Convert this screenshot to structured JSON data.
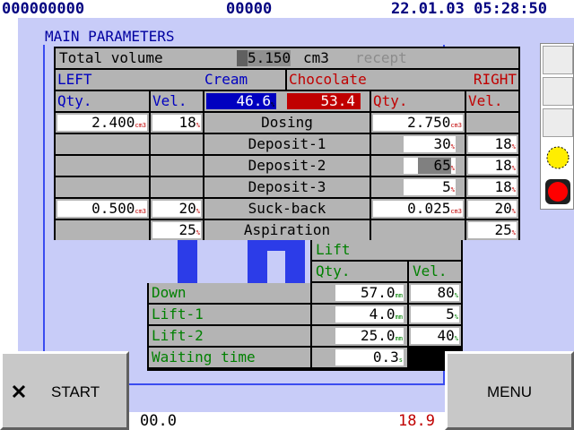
{
  "topbar": {
    "left_counter": "000000000",
    "mid_counter": "00000",
    "datetime": "22.01.03 05:28:50"
  },
  "page_title": "MAIN PARAMETERS",
  "volume": {
    "label": "Total volume",
    "value": "5.150",
    "unit": "cm3",
    "recept": "recept"
  },
  "sides": {
    "left": "LEFT",
    "left_product": "Cream",
    "right_product": "Chocolate",
    "right": "RIGHT"
  },
  "headers": {
    "qty": "Qty.",
    "vel": "Vel."
  },
  "mix": {
    "left_percent": "46.6",
    "right_percent": "53.4",
    "left_fill": 0.466,
    "right_fill": 0.534
  },
  "rows": [
    {
      "label": "Dosing",
      "l_qty": "2.400",
      "l_qty_unit": "cm3",
      "l_vel": "18",
      "r_qty": "2.750",
      "r_qty_unit": "cm3",
      "r_vel": ""
    },
    {
      "label": "Deposit-1",
      "l_qty": "",
      "l_qty_unit": "",
      "l_vel": "",
      "r_qty": "30",
      "r_qty_unit": "%",
      "r_vel": "18"
    },
    {
      "label": "Deposit-2",
      "l_qty": "",
      "l_qty_unit": "",
      "l_vel": "",
      "r_qty": "65",
      "r_qty_unit": "%",
      "r_vel": "18"
    },
    {
      "label": "Deposit-3",
      "l_qty": "",
      "l_qty_unit": "",
      "l_vel": "",
      "r_qty": "5",
      "r_qty_unit": "%",
      "r_vel": "18"
    },
    {
      "label": "Suck-back",
      "l_qty": "0.500",
      "l_qty_unit": "cm3",
      "l_vel": "20",
      "r_qty": "0.025",
      "r_qty_unit": "cm3",
      "r_vel": "20"
    },
    {
      "label": "Aspiration",
      "l_qty": "",
      "l_qty_unit": "",
      "l_vel": "25",
      "r_qty": "",
      "r_qty_unit": "",
      "r_vel": "25"
    }
  ],
  "lift": {
    "title": "Lift",
    "qty_header": "Qty.",
    "vel_header": "Vel.",
    "rows": [
      {
        "label": "Down",
        "qty": "57.0",
        "qty_unit": "mm",
        "vel": "80",
        "vel_unit": "%"
      },
      {
        "label": "Lift-1",
        "qty": "4.0",
        "qty_unit": "mm",
        "vel": "5",
        "vel_unit": "%"
      },
      {
        "label": "Lift-2",
        "qty": "25.0",
        "qty_unit": "mm",
        "vel": "40",
        "vel_unit": "%"
      },
      {
        "label": "Waiting time",
        "qty": "0.3",
        "qty_unit": "s",
        "vel": "",
        "vel_unit": ""
      }
    ]
  },
  "unit_percent": "%",
  "buttons": {
    "start": "START",
    "menu": "MENU"
  },
  "bottom": {
    "left_value": "00.0",
    "right_value": "18.9"
  },
  "indicators": {
    "yellow": "#ffee00",
    "red": "#ff0000"
  },
  "colors": {
    "panel": "#c8ccf8",
    "accent_blue": "#2c3ce8",
    "left_mix": "#0000c0",
    "right_mix": "#c00000"
  }
}
